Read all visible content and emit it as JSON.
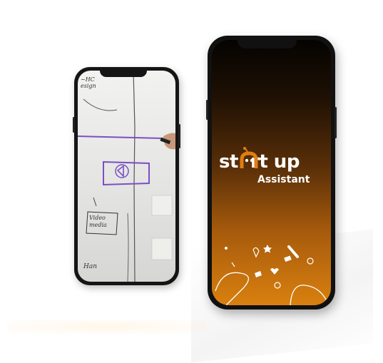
{
  "app": {
    "logo_text": "st  rt up",
    "subtitle": "Assistant"
  },
  "whiteboard": {
    "note_top": "~HC\nesign",
    "note_video": "Video\nmedia",
    "note_bottom": "Han"
  },
  "colors": {
    "gradient_top": "#050301",
    "gradient_bottom": "#d9800f",
    "accent_orange": "#e07f10",
    "marker_purple": "#7b4fc4"
  },
  "icons": [
    "robot-a-icon",
    "star-icon",
    "heart-icon",
    "lightbulb-icon",
    "doodle-icon"
  ]
}
